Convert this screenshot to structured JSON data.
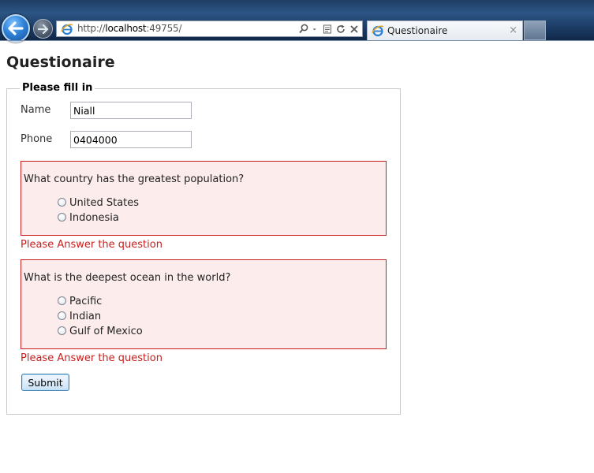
{
  "browser": {
    "url_scheme": "http://",
    "url_host": "localhost",
    "url_port_path": ":49755/",
    "tab_title": "Questionaire",
    "tab_close": "×"
  },
  "page": {
    "title": "Questionaire",
    "legend": "Please fill in",
    "name_label": "Name",
    "name_value": "Niall",
    "phone_label": "Phone",
    "phone_value": "0404000",
    "questions": [
      {
        "text": "What country has the greatest population?",
        "options": [
          "United States",
          "Indonesia"
        ],
        "error": "Please Answer the question"
      },
      {
        "text": "What is the deepest ocean in the world?",
        "options": [
          "Pacific",
          "Indian",
          "Gulf of Mexico"
        ],
        "error": "Please Answer the question"
      }
    ],
    "submit_label": "Submit"
  },
  "colors": {
    "error": "#c81e1e",
    "question_bg": "#fdecec"
  }
}
